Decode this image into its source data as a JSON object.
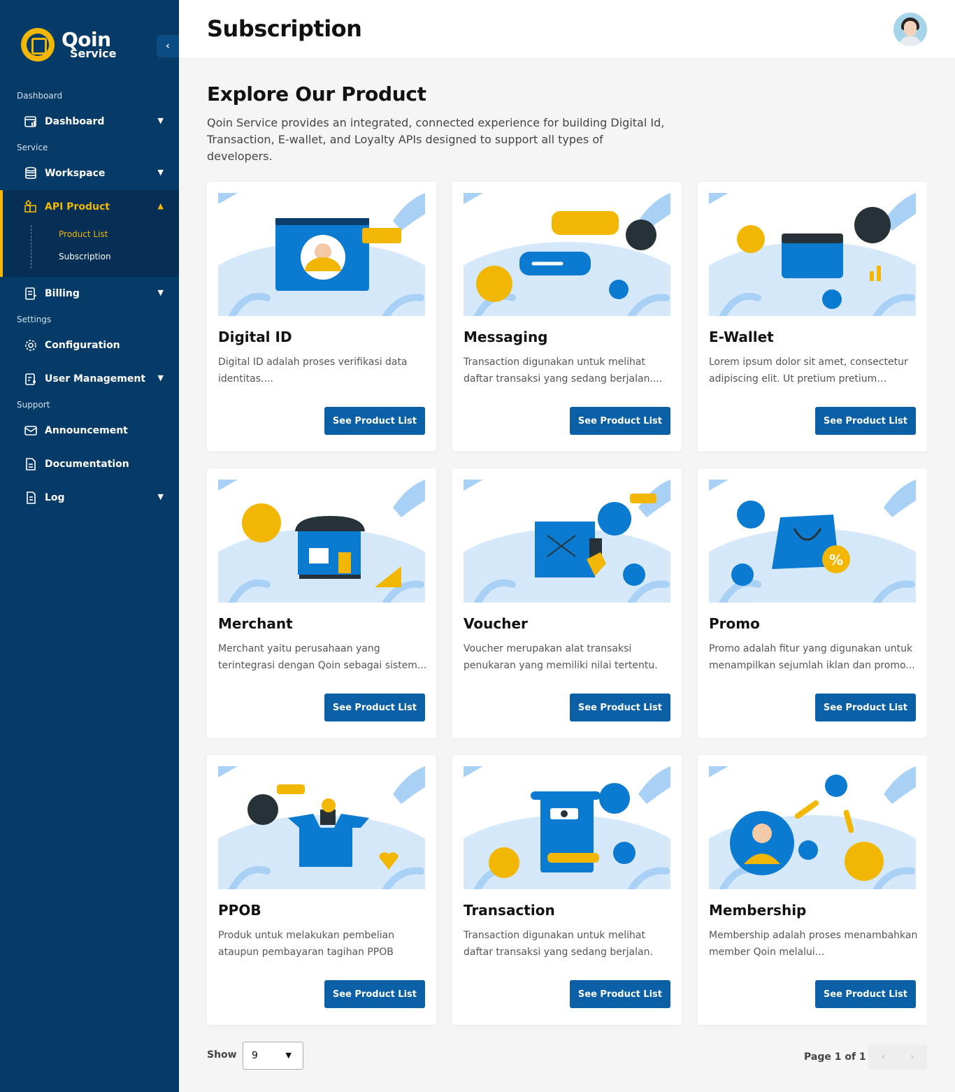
{
  "app": {
    "logo_name": "Qoin",
    "logo_sub": "Service",
    "page_title": "Subscription"
  },
  "sidebar": {
    "sections": [
      {
        "title": "Dashboard"
      },
      {
        "title": "Service"
      },
      {
        "title": "Settings"
      },
      {
        "title": "Support"
      }
    ],
    "items": [
      {
        "label": "Dashboard",
        "icon": "dashboard-icon"
      },
      {
        "label": "Workspace",
        "icon": "database-icon"
      },
      {
        "label": "API Product",
        "icon": "apps-icon"
      },
      {
        "label": "Billing",
        "icon": "invoice-icon"
      },
      {
        "label": "Configuration",
        "icon": "gear-icon"
      },
      {
        "label": "User Management",
        "icon": "user-list-icon"
      },
      {
        "label": "Announcement",
        "icon": "mail-icon"
      },
      {
        "label": "Documentation",
        "icon": "document-icon"
      },
      {
        "label": "Log",
        "icon": "log-icon"
      }
    ],
    "subitems": [
      {
        "label": "Product List"
      },
      {
        "label": "Subscription"
      }
    ]
  },
  "main": {
    "heading": "Explore Our Product",
    "description": "Qoin Service provides  an integrated, connected experience for building Digital Id, Transaction, E-wallet, and Loyalty APIs designed to support all types of developers.",
    "button_label": "See Product List",
    "products": [
      {
        "title": "Digital ID",
        "desc": "Digital ID adalah proses verifikasi data identitas...."
      },
      {
        "title": "Messaging",
        "desc": "Transaction digunakan untuk melihat daftar transaksi yang sedang berjalan...."
      },
      {
        "title": "E-Wallet",
        "desc": "Lorem ipsum dolor sit amet, consectetur adipiscing elit. Ut pretium pretium tempor..."
      },
      {
        "title": "Merchant",
        "desc": "Merchant yaitu perusahaan yang terintegrasi dengan Qoin sebagai sistem..."
      },
      {
        "title": "Voucher",
        "desc": "Voucher merupakan alat transaksi penukaran yang memiliki nilai tertentu."
      },
      {
        "title": "Promo",
        "desc": "Promo adalah fitur yang digunakan untuk menampilkan sejumlah iklan dan promo..."
      },
      {
        "title": "PPOB",
        "desc": "Produk untuk melakukan pembelian ataupun pembayaran tagihan PPOB"
      },
      {
        "title": "Transaction",
        "desc": "Transaction digunakan untuk melihat daftar transaksi yang sedang berjalan."
      },
      {
        "title": "Membership",
        "desc": "Membership adalah proses menambahkan member Qoin melalui..."
      }
    ]
  },
  "pagination": {
    "show_label": "Show",
    "page_size": "9",
    "page_info": "Page 1 of 1",
    "prev": "‹",
    "next": "›"
  },
  "colors": {
    "sidebar": "#063a67",
    "accent": "#f2b705",
    "button": "#0a5fa5",
    "illustration_blue": "#0a7bd1",
    "illustration_light": "#d6e9fb"
  }
}
